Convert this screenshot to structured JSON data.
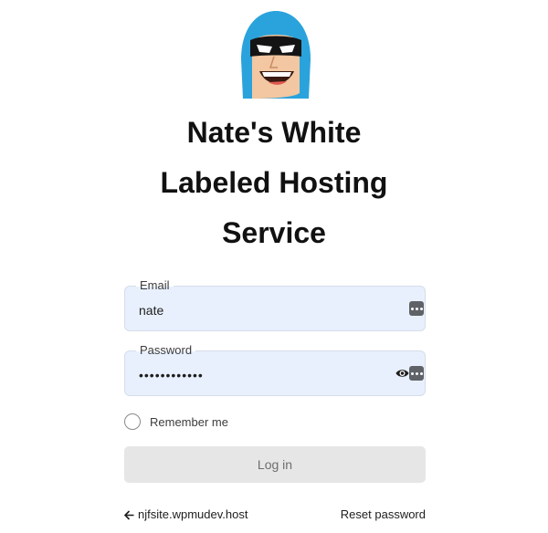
{
  "site": {
    "title_lines": [
      "Nate's White",
      "Labeled Hosting",
      "Service"
    ]
  },
  "form": {
    "email": {
      "label": "Email",
      "value": "nate"
    },
    "password": {
      "label": "Password",
      "value": "••••••••••••"
    },
    "remember_label": "Remember me",
    "submit_label": "Log in"
  },
  "footer": {
    "back_link": "njfsite.wpmudev.host",
    "reset_link": "Reset password"
  },
  "icons": {
    "logo": "superhero-mascot-logo",
    "password_manager": "password-manager-key-icon",
    "show_password": "eye-icon",
    "back": "arrow-left-icon"
  },
  "colors": {
    "input_bg": "#e8f0fe",
    "button_bg": "#e6e6e6",
    "mascot_hood": "#2aa3dc"
  }
}
